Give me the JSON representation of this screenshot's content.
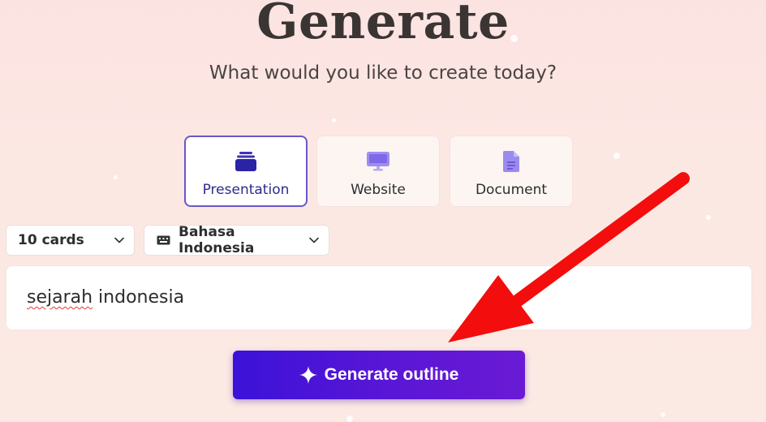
{
  "header": {
    "title": "Generate",
    "subtitle": "What would you like to create today?"
  },
  "content_types": [
    {
      "label": "Presentation",
      "icon": "presentation-stack-icon",
      "selected": true
    },
    {
      "label": "Website",
      "icon": "monitor-icon",
      "selected": false
    },
    {
      "label": "Document",
      "icon": "document-icon",
      "selected": false
    }
  ],
  "options": {
    "cards": {
      "value": "10 cards",
      "icon": "chevron-down-icon"
    },
    "language": {
      "value": "Bahasa Indonesia",
      "icon": "keyboard-icon"
    }
  },
  "prompt": {
    "value": "sejarah indonesia",
    "misspelled_word": "sejarah",
    "rest": " indonesia"
  },
  "generate_button": {
    "label": "Generate outline",
    "icon": "sparkle-icon"
  },
  "annotation": {
    "type": "red-arrow",
    "color": "#f40d0d",
    "points_to": "generate-outline-button"
  },
  "colors": {
    "accent": "#5b3fd0",
    "button_start": "#3c12d8",
    "button_end": "#6a1ad4",
    "background": "#fbe6e3"
  }
}
